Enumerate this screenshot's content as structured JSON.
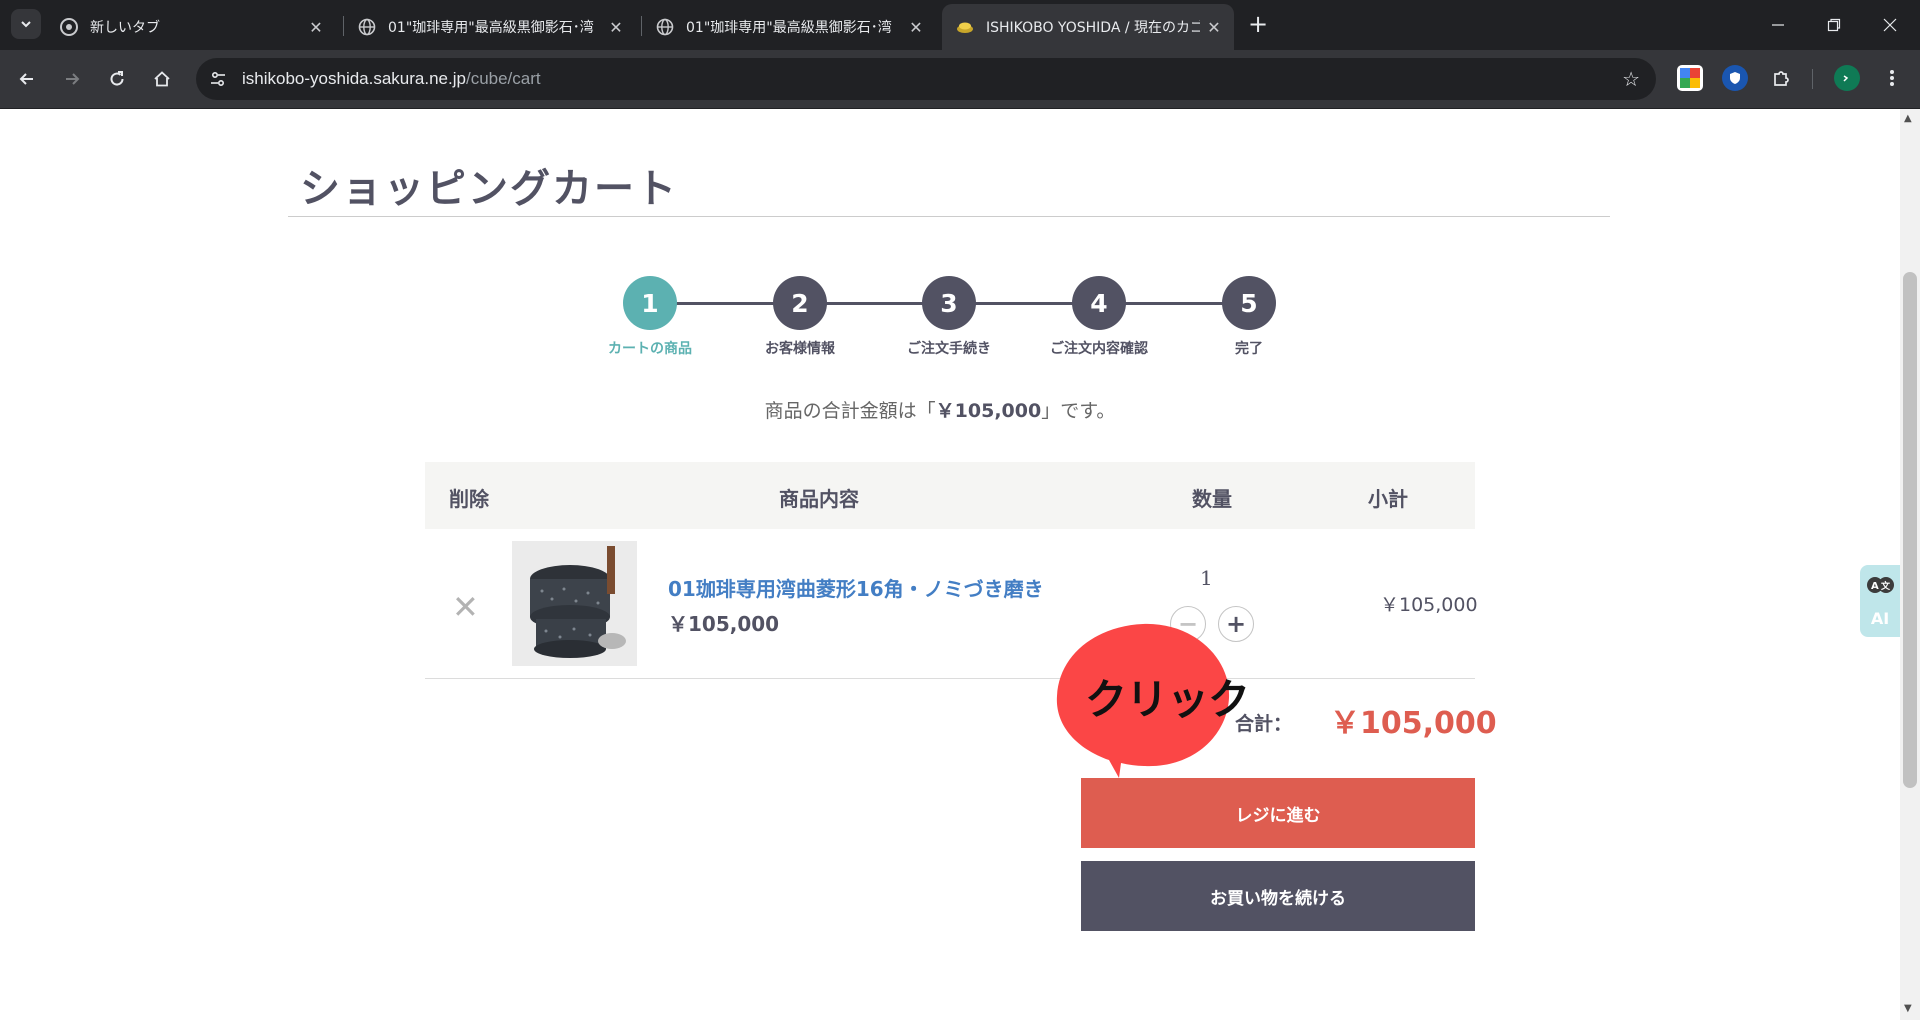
{
  "browser": {
    "tabs": [
      {
        "title": "新しいタブ",
        "active": false
      },
      {
        "title": "01\"珈琲専用\"最高級黒御影石･湾",
        "active": false
      },
      {
        "title": "01\"珈琲専用\"最高級黒御影石･湾",
        "active": false
      },
      {
        "title": "ISHIKOBO YOSHIDA / 現在のカゴ",
        "active": true
      }
    ],
    "url_host": "ishikobo-yoshida.sakura.ne.jp",
    "url_path": "/cube/cart"
  },
  "page": {
    "title": "ショッピングカート",
    "steps": [
      {
        "num": "1",
        "label": "カートの商品",
        "active": true
      },
      {
        "num": "2",
        "label": "お客様情報",
        "active": false
      },
      {
        "num": "3",
        "label": "ご注文手続き",
        "active": false
      },
      {
        "num": "4",
        "label": "ご注文内容確認",
        "active": false
      },
      {
        "num": "5",
        "label": "完了",
        "active": false
      }
    ],
    "total_msg_pre": "商品の合計金額は「",
    "total_msg_amount": "￥105,000",
    "total_msg_post": "」です。",
    "table": {
      "headers": {
        "delete": "削除",
        "content": "商品内容",
        "qty": "数量",
        "subtotal": "小計"
      },
      "rows": [
        {
          "name": "01珈琲専用湾曲菱形16角・ノミづき磨き",
          "price": "￥105,000",
          "qty": "1",
          "subtotal": "￥105,000"
        }
      ]
    },
    "total_label": "合計：",
    "total_value": "￥105,000",
    "checkout_label": "レジに進む",
    "continue_label": "お買い物を続ける",
    "annotation": "クリック",
    "ai_widget_label": "AI"
  },
  "colors": {
    "accent_teal": "#5cb1b1",
    "accent_red": "#de5d50",
    "dark": "#525263"
  }
}
